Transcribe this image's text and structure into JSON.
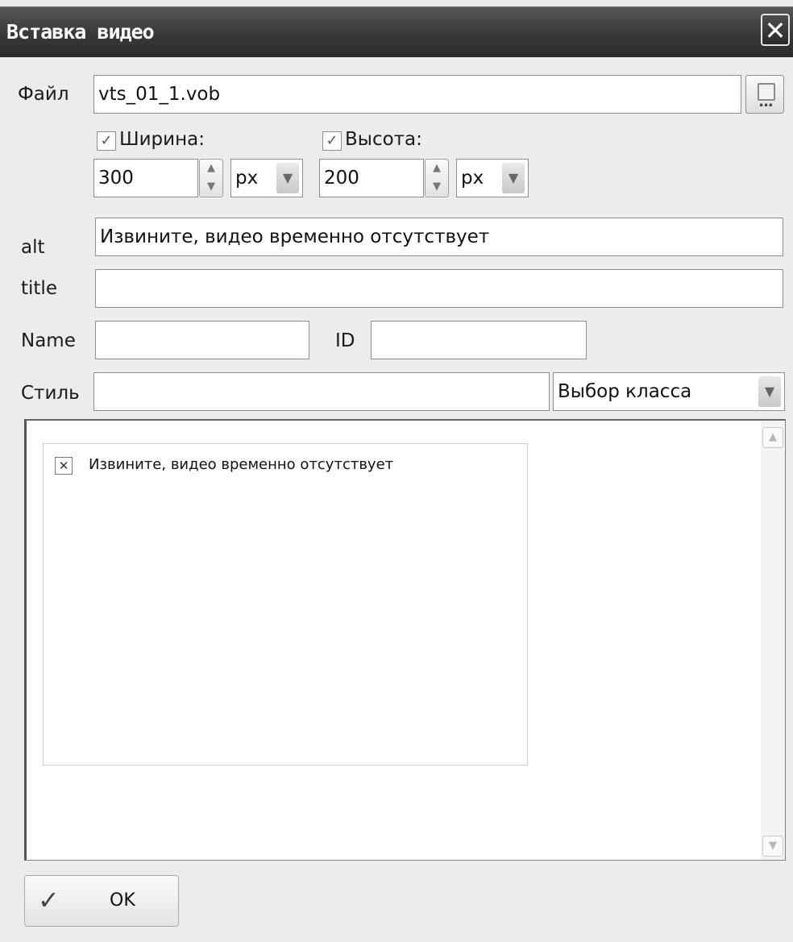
{
  "window": {
    "title": "Вставка видео",
    "close_symbol": "✕"
  },
  "file": {
    "label": "Файл",
    "value": "vts_01_1.vob",
    "browse_dots": "..."
  },
  "width": {
    "checked": true,
    "label": "Ширина:",
    "value": "300",
    "unit": "px"
  },
  "height": {
    "checked": true,
    "label": "Высота:",
    "value": "200",
    "unit": "px"
  },
  "alt": {
    "label": "alt",
    "value": "Извините, видео временно отсутствует"
  },
  "title_field": {
    "label": "title",
    "value": ""
  },
  "name": {
    "label": "Name",
    "value": ""
  },
  "id": {
    "label": "ID",
    "value": ""
  },
  "style": {
    "label": "Стиль",
    "value": "",
    "class_select": "Выбор класса"
  },
  "preview": {
    "alt_text": "Извините, видео временно отсутствует",
    "broken_icon": "✕"
  },
  "ok_button": {
    "label": "OK",
    "icon": "check-icon"
  },
  "glyphs": {
    "check": "✓",
    "spin_up": "▲",
    "spin_down": "▼",
    "arrow_down": "▼",
    "arrow_up": "▲"
  }
}
